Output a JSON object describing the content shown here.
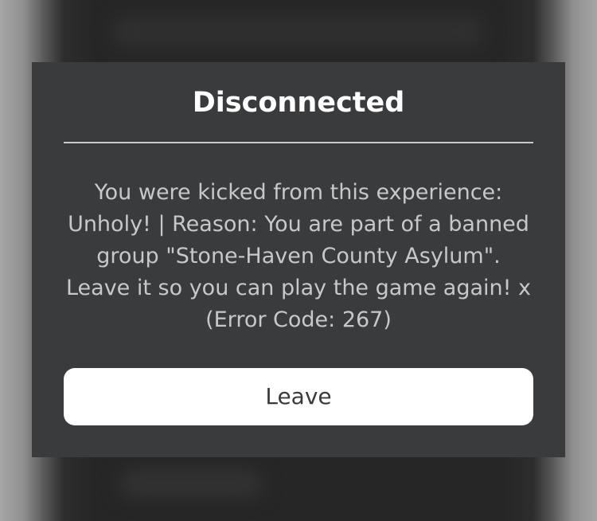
{
  "dialog": {
    "title": "Disconnected",
    "message_lines": [
      "You were kicked from this experience:",
      "Unholy! | Reason: You are part of a banned",
      "group \"Stone-Haven County Asylum\".",
      "Leave it so you can play the game again! x",
      "(Error Code: 267)"
    ],
    "leave_label": "Leave"
  },
  "colors": {
    "dialog_background": "#393b3d",
    "title_text": "#ffffff",
    "message_text": "#c8c8c8",
    "button_background": "#ffffff",
    "button_text": "#393b3d",
    "divider": "#c9c9c9"
  }
}
